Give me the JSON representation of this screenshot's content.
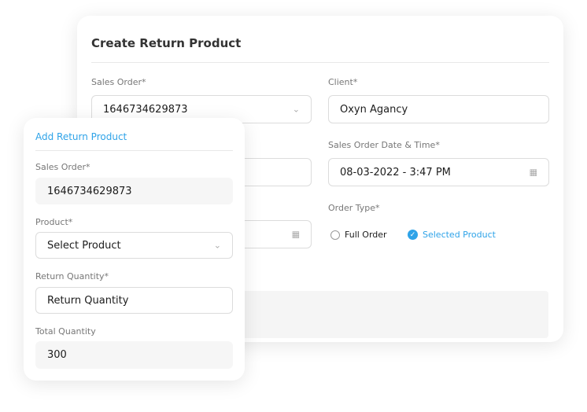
{
  "create": {
    "title": "Create Return Product",
    "sales_order": {
      "label": "Sales Order*",
      "value": "1646734629873"
    },
    "client": {
      "label": "Client*",
      "value": "Oxyn Agancy"
    },
    "sales_order_date": {
      "label": "Sales Order Date & Time*",
      "value": "08-03-2022 - 3:47 PM"
    },
    "order_type": {
      "label": "Order Type*",
      "options": [
        "Full Order",
        "Selected Product"
      ],
      "selected": "Selected Product"
    }
  },
  "add": {
    "title": "Add Return Product",
    "sales_order": {
      "label": "Sales Order*",
      "value": "1646734629873"
    },
    "product": {
      "label": "Product*",
      "placeholder": "Select Product"
    },
    "return_quantity": {
      "label": "Return Quantity*",
      "placeholder": "Return Quantity"
    },
    "total_quantity": {
      "label": "Total Quantity",
      "value": "300"
    }
  },
  "colors": {
    "accent": "#2ea3e8"
  }
}
